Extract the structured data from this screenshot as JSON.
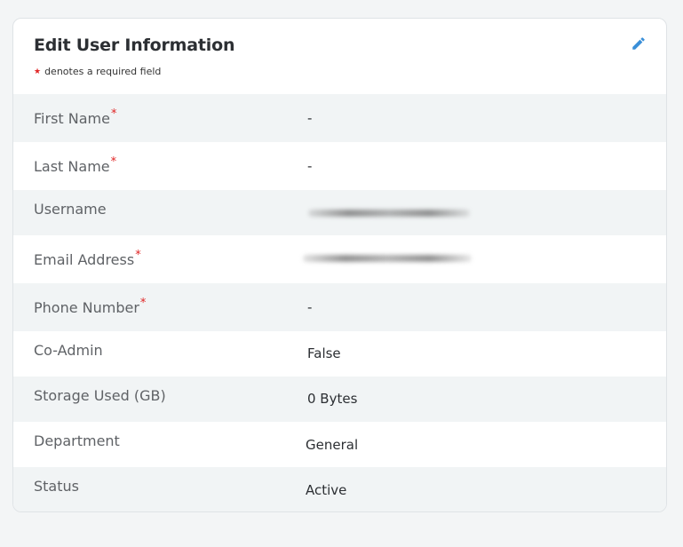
{
  "card": {
    "title": "Edit User Information",
    "required_note": "denotes a required field",
    "required_marker": "★",
    "required_asterisk": "*"
  },
  "icons": {
    "edit": "pencil-icon"
  },
  "colors": {
    "accent": "#3a8fd8",
    "required": "#e02424",
    "shaded_row": "#f1f4f5"
  },
  "fields": [
    {
      "label": "First Name",
      "required": true,
      "value": "-"
    },
    {
      "label": "Last Name",
      "required": true,
      "value": "-"
    },
    {
      "label": "Username",
      "required": false,
      "value": ""
    },
    {
      "label": "Email Address",
      "required": true,
      "value": ""
    },
    {
      "label": "Phone Number",
      "required": true,
      "value": "-"
    },
    {
      "label": "Co-Admin",
      "required": false,
      "value": "False"
    },
    {
      "label": "Storage Used (GB)",
      "required": false,
      "value": "0 Bytes"
    },
    {
      "label": "Department",
      "required": false,
      "value": "General"
    },
    {
      "label": "Status",
      "required": false,
      "value": "Active"
    }
  ]
}
